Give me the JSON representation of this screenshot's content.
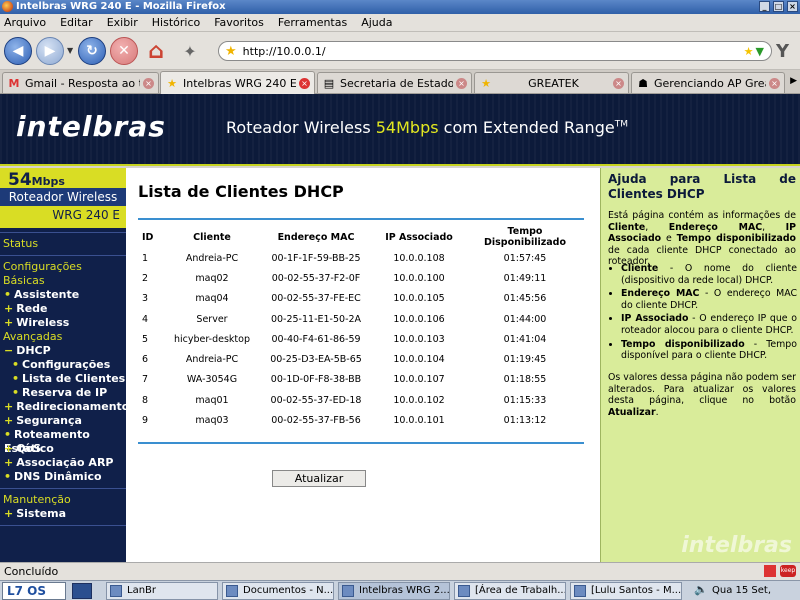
{
  "window": {
    "title": "Intelbras WRG 240 E - Mozilla Firefox"
  },
  "menu": [
    "Arquivo",
    "Editar",
    "Exibir",
    "Histórico",
    "Favoritos",
    "Ferramentas",
    "Ajuda"
  ],
  "toolbar": {
    "url": "http://10.0.0.1/"
  },
  "tabs": [
    {
      "label": "Gmail - Resposta ao t...",
      "icon": "gmail-icon"
    },
    {
      "label": "Intelbras WRG 240 E",
      "icon": "star-icon"
    },
    {
      "label": "Secretaria de Estado d...",
      "icon": "page-icon"
    },
    {
      "label": "GREATEK",
      "icon": "star-icon"
    },
    {
      "label": "Gerenciando AP Great...",
      "icon": "router-icon"
    }
  ],
  "brand": {
    "logo": "intelbras",
    "tagline_prefix": "Roteador Wireless ",
    "tagline_accent": "54Mbps",
    "tagline_suffix": " com Extended Range",
    "tagline_tm": "TM"
  },
  "sidebar": {
    "speed": "54",
    "speed_unit": "Mbps",
    "product": "Roteador Wireless",
    "model": "WRG 240 E",
    "status": "Status",
    "config_basic_1": "Configurações",
    "config_basic_2": "Básicas",
    "assistente": "Assistente",
    "rede": "Rede",
    "wireless": "Wireless",
    "advanced": "Avançadas",
    "dhcp": "DHCP",
    "dhcp_config": "Configurações",
    "dhcp_clients": "Lista de Clientes",
    "dhcp_reserve": "Reserva de IP",
    "redirect": "Redirecionamento",
    "security": "Segurança",
    "static_route": "Roteamento Estático",
    "qos": "QoS",
    "arp": "Associação ARP",
    "ddns": "DNS Dinâmico",
    "maintenance": "Manutenção",
    "system": "Sistema"
  },
  "main": {
    "title": "Lista de Clientes DHCP",
    "headers": {
      "id": "ID",
      "client": "Cliente",
      "mac": "Endereço MAC",
      "ip": "IP Associado",
      "time": "Tempo Disponibilizado"
    },
    "rows": [
      {
        "id": "1",
        "client": "Andreia-PC",
        "mac": "00-1F-1F-59-BB-25",
        "ip": "10.0.0.108",
        "time": "01:57:45"
      },
      {
        "id": "2",
        "client": "maq02",
        "mac": "00-02-55-37-F2-0F",
        "ip": "10.0.0.100",
        "time": "01:49:11"
      },
      {
        "id": "3",
        "client": "maq04",
        "mac": "00-02-55-37-FE-EC",
        "ip": "10.0.0.105",
        "time": "01:45:56"
      },
      {
        "id": "4",
        "client": "Server",
        "mac": "00-25-11-E1-50-2A",
        "ip": "10.0.0.106",
        "time": "01:44:00"
      },
      {
        "id": "5",
        "client": "hicyber-desktop",
        "mac": "00-40-F4-61-86-59",
        "ip": "10.0.0.103",
        "time": "01:41:04"
      },
      {
        "id": "6",
        "client": "Andreia-PC",
        "mac": "00-25-D3-EA-5B-65",
        "ip": "10.0.0.104",
        "time": "01:19:45"
      },
      {
        "id": "7",
        "client": "WA-3054G",
        "mac": "00-1D-0F-F8-38-BB",
        "ip": "10.0.0.107",
        "time": "01:18:55"
      },
      {
        "id": "8",
        "client": "maq01",
        "mac": "00-02-55-37-ED-18",
        "ip": "10.0.0.102",
        "time": "01:15:33"
      },
      {
        "id": "9",
        "client": "maq03",
        "mac": "00-02-55-37-FB-56",
        "ip": "10.0.0.101",
        "time": "01:13:12"
      }
    ],
    "refresh_label": "Atualizar"
  },
  "help": {
    "title": "Ajuda para Lista de Clientes DHCP",
    "intro_1": "Está página contém as informações de ",
    "intro_b1": "Cliente",
    "intro_2": ", ",
    "intro_b2": "Endereço MAC",
    "intro_3": ", ",
    "intro_b3": "IP Associado",
    "intro_4": " e ",
    "intro_b4": "Tempo disponibilizado",
    "intro_5": " de cada cliente DHCP conectado ao roteador.",
    "items": [
      {
        "term": "Cliente",
        "desc": " - O nome do cliente (dispositivo da rede local) DHCP."
      },
      {
        "term": "Endereço MAC",
        "desc": " - O endereço MAC do cliente DHCP."
      },
      {
        "term": "IP Associado",
        "desc": " - O endereço IP que o roteador alocou para o cliente DHCP."
      },
      {
        "term": "Tempo disponibilizado",
        "desc": " - Tempo disponível para o cliente DHCP."
      }
    ],
    "outro_1": "Os valores dessa página não podem ser alterados. Para atualizar os valores desta página, clique no botão ",
    "outro_b": "Atualizar",
    "outro_2": ".",
    "watermark": "intelbras"
  },
  "status": {
    "text": "Concluído"
  },
  "taskbar": {
    "logo": "L7 OS",
    "items": [
      "LanBr",
      "Documentos - N...",
      "Intelbras WRG 2...",
      "[Área de Trabalh...",
      "[Lulu Santos - M..."
    ],
    "clock": "Qua 15 Set, 16:47"
  }
}
